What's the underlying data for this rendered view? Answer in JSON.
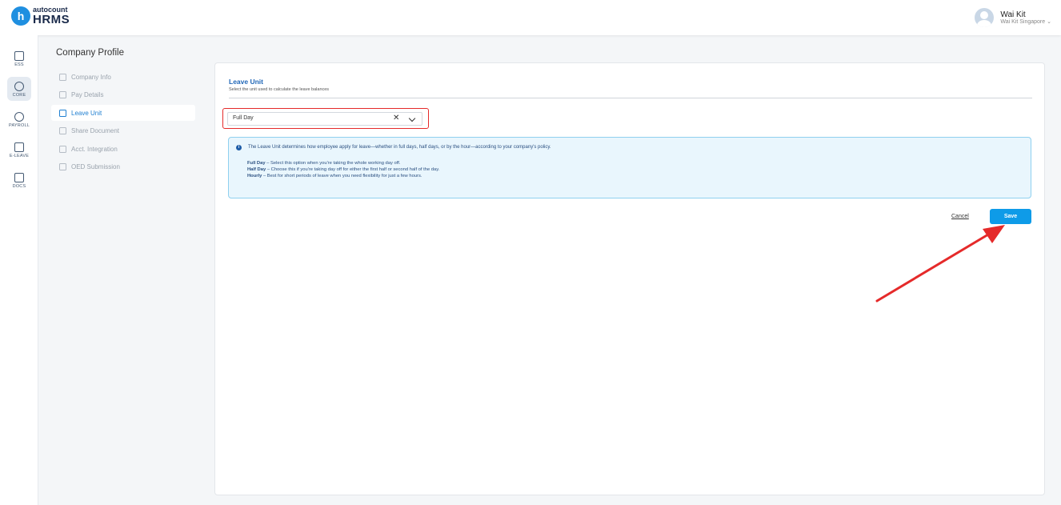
{
  "header": {
    "brand": "autocount",
    "product": "HRMS",
    "logo_letter": "h",
    "user_name": "Wai Kit",
    "user_company": "Wai Kit Singapore"
  },
  "rail": {
    "items": [
      {
        "label": "ESS",
        "icon": "ess-icon"
      },
      {
        "label": "CORE",
        "icon": "core-icon"
      },
      {
        "label": "PAYROLL",
        "icon": "payroll-icon"
      },
      {
        "label": "E-LEAVE",
        "icon": "e-leave-icon"
      },
      {
        "label": "DOCS",
        "icon": "docs-icon"
      }
    ],
    "active": "CORE"
  },
  "sidebar": {
    "title": "Company Profile",
    "items": [
      {
        "label": "Company Info",
        "icon": "home-icon"
      },
      {
        "label": "Pay Details",
        "icon": "pay-details-icon"
      },
      {
        "label": "Leave Unit",
        "icon": "calendar-icon"
      },
      {
        "label": "Share Document",
        "icon": "document-icon"
      },
      {
        "label": "Acct. Integration",
        "icon": "integration-icon"
      },
      {
        "label": "OED Submission",
        "icon": "submission-icon"
      }
    ],
    "active": "Leave Unit"
  },
  "main": {
    "title": "Leave Unit",
    "subtitle": "Select the unit used to calculate the leave balances",
    "select": {
      "value": "Full Day",
      "clear": "✕"
    },
    "info": {
      "intro": "The Leave Unit determines how employee apply for leave—whether in full days, half days, or by the hour—according to your company's policy.",
      "lines": [
        {
          "term": "Full Day",
          "desc": " – Select this option when you're taking the whole working day off."
        },
        {
          "term": "Half Day",
          "desc": " – Choose this if you're taking day off for either the first half or second half of the day."
        },
        {
          "term": "Hourly",
          "desc": " – Best for short periods of leave when you need flexibility for just a few hours."
        }
      ]
    },
    "cancel_label": "Cancel",
    "save_label": "Save"
  },
  "colors": {
    "accent": "#0e9be8",
    "highlight": "#e52a2a",
    "title_blue": "#2268b8",
    "info_bg": "#e9f6fd"
  }
}
